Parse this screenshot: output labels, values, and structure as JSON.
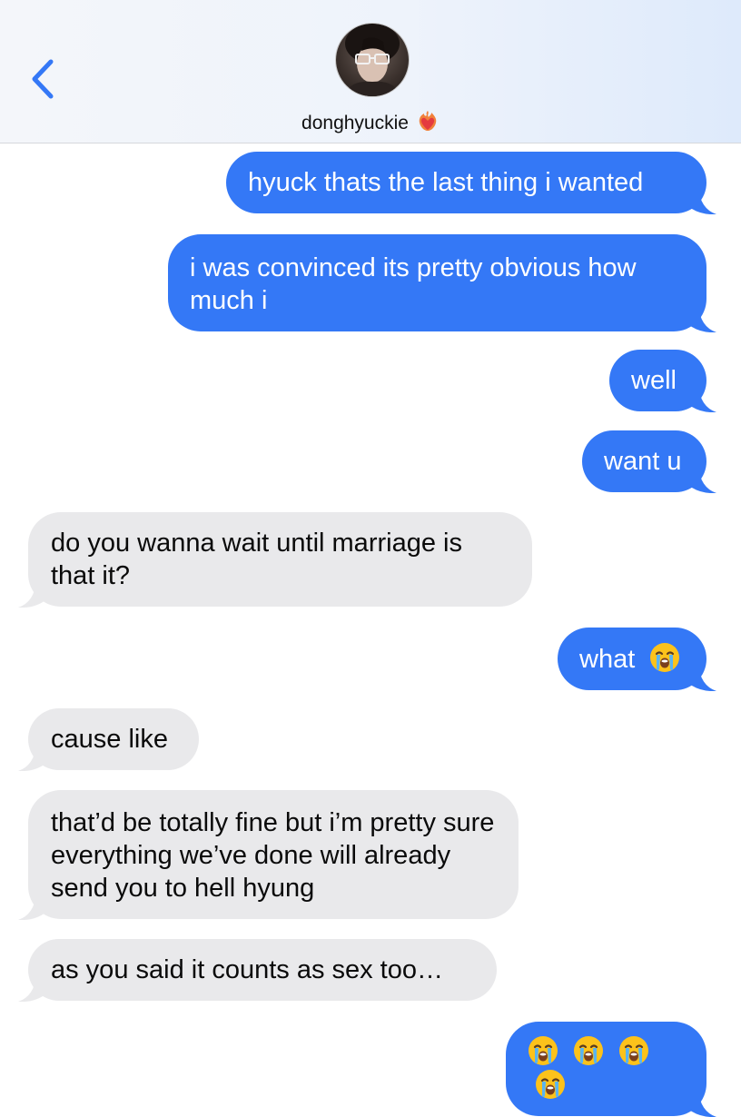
{
  "header": {
    "contact_name": "donghyuckie",
    "back_icon": "chevron-left-icon",
    "heart_icon": "heart-on-fire-icon"
  },
  "colors": {
    "sent": "#3478f6",
    "received": "#e9e9eb",
    "accent": "#3478f6"
  },
  "messages": [
    {
      "direction": "sent",
      "text": "hyuck thats the last thing i wanted"
    },
    {
      "direction": "sent",
      "text": "i was convinced its pretty obvious how much i"
    },
    {
      "direction": "sent",
      "text": "well"
    },
    {
      "direction": "sent",
      "text": "want u"
    },
    {
      "direction": "received",
      "text": "do you wanna wait until marriage is that it?"
    },
    {
      "direction": "sent",
      "text": "what",
      "emoji": [
        "loudly-crying-face"
      ]
    },
    {
      "direction": "received",
      "text": "cause like"
    },
    {
      "direction": "received",
      "text": "that’d be totally fine but i’m pretty sure everything we’ve done will already send you to hell hyung"
    },
    {
      "direction": "received",
      "text": "as you said it counts as sex too…"
    },
    {
      "direction": "sent",
      "text": "",
      "emoji": [
        "loudly-crying-face",
        "loudly-crying-face",
        "loudly-crying-face",
        "loudly-crying-face"
      ]
    }
  ]
}
